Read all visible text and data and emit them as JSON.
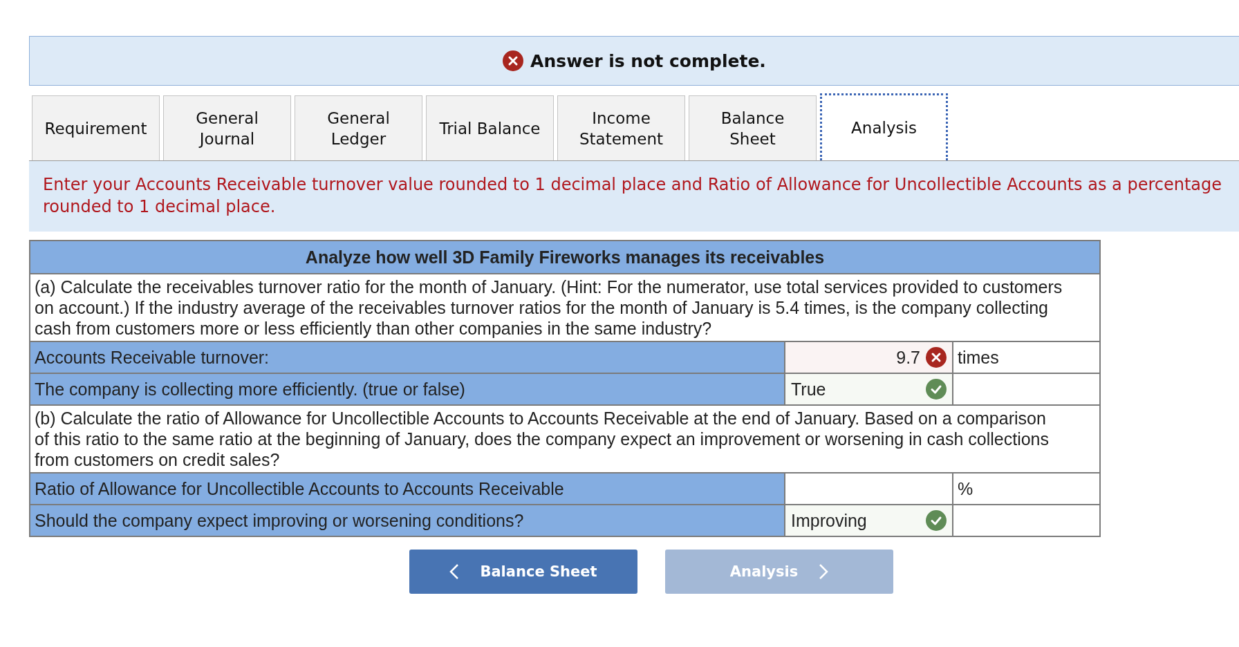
{
  "banner": {
    "complete": false,
    "text": "Answer is not complete."
  },
  "tabs": [
    {
      "label": "Requirement",
      "selected": false
    },
    {
      "label": "General Journal",
      "selected": false
    },
    {
      "label": "General Ledger",
      "selected": false
    },
    {
      "label": "Trial Balance",
      "selected": false
    },
    {
      "label": "Income Statement",
      "selected": false
    },
    {
      "label": "Balance Sheet",
      "selected": false
    },
    {
      "label": "Analysis",
      "selected": true
    }
  ],
  "instruction": "Enter your Accounts Receivable turnover value rounded to 1 decimal place and Ratio of Allowance for Uncollectible Accounts as a percentage rounded to 1 decimal place.",
  "table": {
    "title": "Analyze how well 3D Family Fireworks manages its receivables",
    "rows": [
      {
        "kind": "question",
        "text": "(a) Calculate the receivables turnover ratio for the month of January. (Hint: For the numerator, use total services provided to customers on account.) If the industry average of the receivables turnover ratios for the month of January is 5.4 times, is the company collecting cash from customers more or less efficiently than other companies in the same industry?"
      },
      {
        "kind": "answer",
        "label": "Accounts Receivable turnover:",
        "answer": {
          "kind": "number",
          "value": "9.7",
          "correct": false
        },
        "unit": "times"
      },
      {
        "kind": "answer",
        "label": "The company is collecting more efficiently. (true or false)",
        "answer": {
          "kind": "choice",
          "value": "True",
          "correct": true
        }
      },
      {
        "kind": "question",
        "text": "(b) Calculate the ratio of Allowance for Uncollectible Accounts to Accounts Receivable at the end of January. Based on a comparison of this ratio to the same ratio at the beginning of January, does the company expect an improvement or worsening in cash collections from customers on credit sales?"
      },
      {
        "kind": "answer",
        "label": "Ratio of Allowance for Uncollectible Accounts to Accounts Receivable",
        "answer": {
          "kind": "number"
        },
        "unit": "%"
      },
      {
        "kind": "answer",
        "label": "Should the company expect improving or worsening conditions?",
        "answer": {
          "kind": "choice",
          "value": "Improving",
          "correct": true
        }
      }
    ]
  },
  "nav": [
    {
      "kind": "prev",
      "label": "Balance Sheet",
      "disabled": false
    },
    {
      "kind": "next",
      "label": "Analysis",
      "disabled": true
    }
  ]
}
